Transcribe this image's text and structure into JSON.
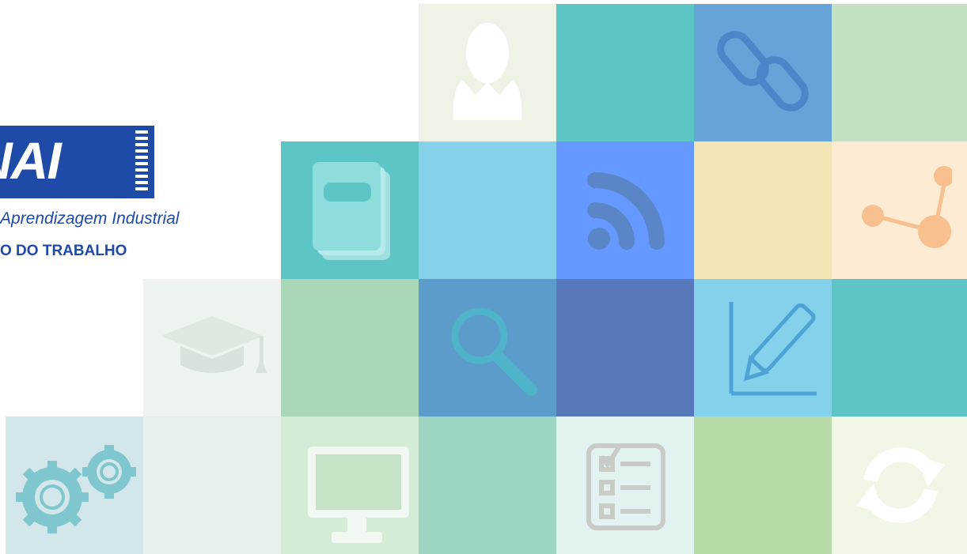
{
  "logo": {
    "wordmark": "NAI",
    "tagline": "Aprendizagem Industrial",
    "subtitle": "O DO TRABALHO"
  },
  "tiles": [
    {
      "name": "person-icon-tile",
      "color": "#edf3e6",
      "icon": "person-icon"
    },
    {
      "name": "teal-tile",
      "color": "#5ec5c7",
      "icon": ""
    },
    {
      "name": "link-icon-tile",
      "color": "#65a3d8",
      "icon": "chain-link-icon"
    },
    {
      "name": "green-tile",
      "color": "#c3e0c3",
      "icon": ""
    },
    {
      "name": "book-icon-tile",
      "color": "#5ec5c7",
      "icon": "notebook-icon"
    },
    {
      "name": "sky-tile",
      "color": "#86d1ea",
      "icon": ""
    },
    {
      "name": "rss-icon-tile",
      "color": "#6599ff",
      "icon": "rss-feed-icon"
    },
    {
      "name": "yellow-tile",
      "color": "#f2e6b6",
      "icon": ""
    },
    {
      "name": "share-icon-tile",
      "color": "#fdebd3",
      "icon": "share-nodes-icon"
    },
    {
      "name": "graduation-icon-tile",
      "color": "#edf4ee",
      "icon": "graduation-cap-icon"
    },
    {
      "name": "sage-tile",
      "color": "#abd7b9",
      "icon": ""
    },
    {
      "name": "search-icon-tile",
      "color": "#5c9cca",
      "icon": "magnifier-icon"
    },
    {
      "name": "indigo-tile",
      "color": "#5778ba",
      "icon": ""
    },
    {
      "name": "pencil-chart-icon-tile",
      "color": "#84d1ec",
      "icon": "pencil-chart-icon"
    },
    {
      "name": "teal-tile-2",
      "color": "#5ec5c7",
      "icon": ""
    },
    {
      "name": "gears-icon-tile",
      "color": "#d3e7ea",
      "icon": "gears-icon"
    },
    {
      "name": "pale-tile",
      "color": "#e5f1e9",
      "icon": ""
    },
    {
      "name": "monitor-icon-tile",
      "color": "#d4ebd6",
      "icon": "computer-monitor-icon"
    },
    {
      "name": "mint-tile",
      "color": "#9dd5c3",
      "icon": ""
    },
    {
      "name": "checklist-icon-tile",
      "color": "#e1f2f1",
      "icon": "checklist-icon"
    },
    {
      "name": "lime-tile",
      "color": "#b7dba7",
      "icon": ""
    },
    {
      "name": "refresh-icon-tile",
      "color": "#f1f7e6",
      "icon": "refresh-arrows-icon"
    }
  ]
}
